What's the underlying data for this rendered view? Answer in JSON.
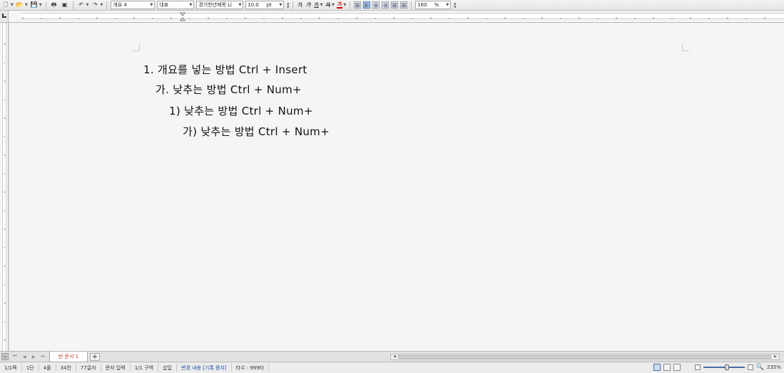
{
  "toolbar": {
    "style_combo": "개요 4",
    "font_category_combo": "대표",
    "font_name_combo": "경기천년제목 Li",
    "font_size_combo": "10.0",
    "font_unit_combo": "pt",
    "font_buttons": [
      "가",
      "가",
      "가",
      "가",
      "가"
    ],
    "zoom_combo": "160",
    "zoom_unit": "%"
  },
  "document": {
    "lines": [
      "1. 개요를 넣는 방법 Ctrl + Insert",
      "가. 낮추는 방법 Ctrl + Num+",
      "1) 낮추는 방법 Ctrl + Num+",
      "가) 낮추는 방법 Ctrl + Num+"
    ]
  },
  "tabs": {
    "active_tab": "빈 문서 1",
    "add_label": "+"
  },
  "statusbar": {
    "page": "1/1쪽",
    "column": "1단",
    "line": "4줄",
    "col_pos": "34칸",
    "char_count": "77글자",
    "input_mode": "문자 입력",
    "section": "1/1 구역",
    "insert_mode": "삽입",
    "track_changes": "변경 내용 [기록 중지]",
    "typing_speed": "타수 : 999타",
    "zoom": "235%"
  },
  "colors": {
    "tab_text": "#c0392b",
    "track_changes_text": "#1f4fa3"
  }
}
